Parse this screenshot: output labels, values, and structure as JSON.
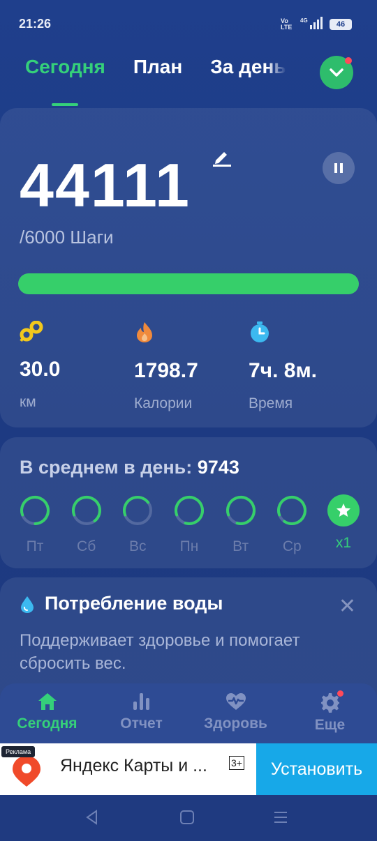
{
  "status_bar": {
    "time": "21:26",
    "network": "Vo LTE",
    "signal": "4G",
    "battery": "46"
  },
  "tabs": [
    {
      "label": "Сегодня",
      "active": true
    },
    {
      "label": "План",
      "active": false
    },
    {
      "label": "За день",
      "active": false
    }
  ],
  "steps": {
    "value": "44111",
    "goal_text": "/6000 Шаги",
    "progress_fraction": 1.0
  },
  "stats": [
    {
      "value": "30.0",
      "label": "км",
      "icon": "route-icon",
      "color": "#f2c81c"
    },
    {
      "value": "1798.7",
      "label": "Калории",
      "icon": "flame-icon",
      "color": "#f08a3c"
    },
    {
      "value": "7ч. 8м.",
      "label": "Время",
      "icon": "clock-icon",
      "color": "#3cb9f0"
    }
  ],
  "average": {
    "label": "В среднем в день: ",
    "value": "9743"
  },
  "days": [
    {
      "label": "Пт",
      "progress": 0.8
    },
    {
      "label": "Сб",
      "progress": 0.7
    },
    {
      "label": "Вс",
      "progress": 0.45
    },
    {
      "label": "Пн",
      "progress": 0.85
    },
    {
      "label": "Вт",
      "progress": 0.85
    },
    {
      "label": "Ср",
      "progress": 0.9
    },
    {
      "label": "x1",
      "star": true
    }
  ],
  "water": {
    "title": "Потребление воды",
    "description": "Поддерживает здоровье и помогает сбросить вес."
  },
  "bottom_nav": [
    {
      "label": "Сегодня",
      "icon": "home-icon",
      "active": true
    },
    {
      "label": "Отчет",
      "icon": "bar-chart-icon",
      "active": false
    },
    {
      "label": "Здоровь",
      "icon": "heart-pulse-icon",
      "active": false
    },
    {
      "label": "Еще",
      "icon": "gear-icon",
      "active": false,
      "badge": true
    }
  ],
  "ad": {
    "tag": "Реклама",
    "text": "Яндекс Карты и ...",
    "age": "3+",
    "button": "Установить"
  },
  "colors": {
    "accent_green": "#35d07a",
    "background": "#1f3f8c",
    "install_blue": "#17a8e8"
  }
}
